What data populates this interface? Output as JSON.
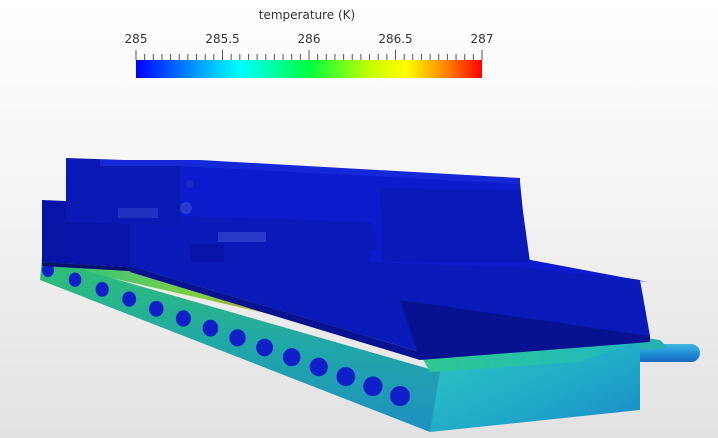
{
  "legend": {
    "title": "temperature (K)",
    "ticks": [
      "285",
      "285.5",
      "286",
      "286.5",
      "287"
    ],
    "min": 285,
    "max": 287,
    "colormap": [
      "#0000ff",
      "#00a0ff",
      "#00ffff",
      "#00ff40",
      "#c8ff00",
      "#ffff00",
      "#ff8000",
      "#ff0000"
    ]
  },
  "colors": {
    "cold": "#0a1ab8",
    "cold_dark": "#061290",
    "cold_shadow": "#050f70",
    "mid": "#20c090",
    "warm": "#d07020"
  }
}
